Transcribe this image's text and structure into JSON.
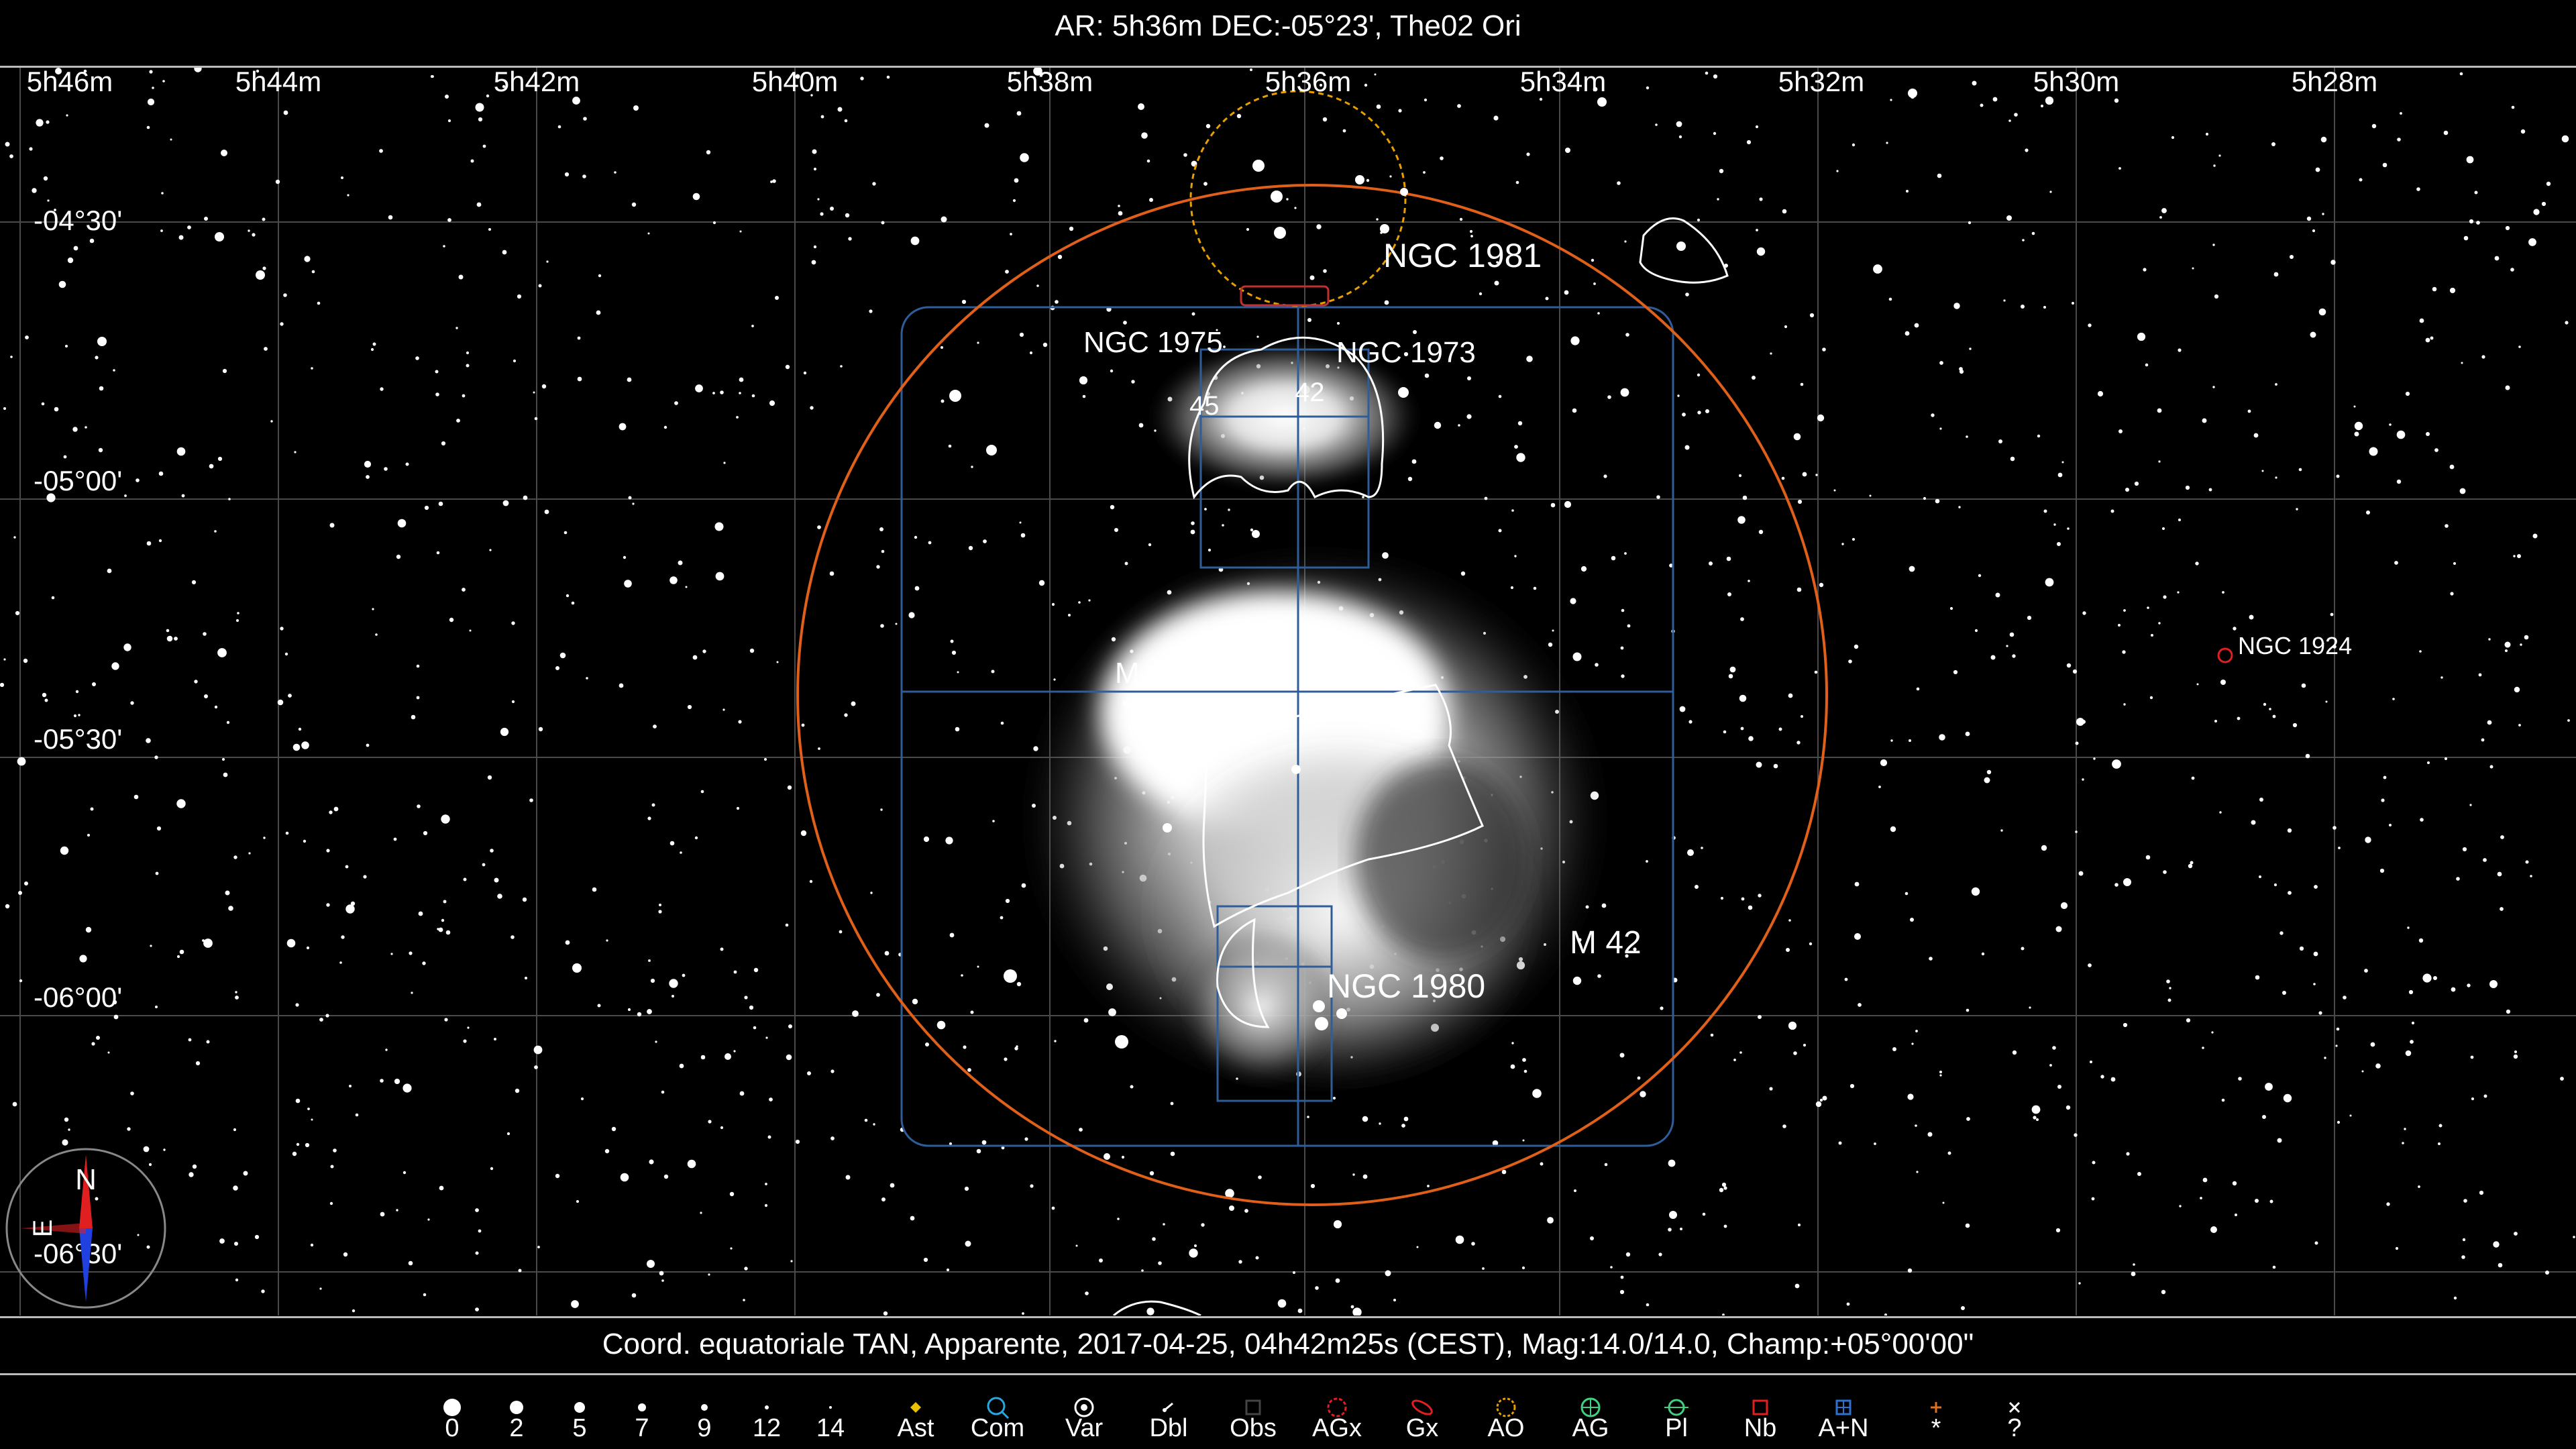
{
  "header": {
    "title": "AR:  5h36m DEC:-05°23', The02 Ori"
  },
  "ra_labels": [
    "5h46m",
    "5h44m",
    "5h42m",
    "5h40m",
    "5h38m",
    "5h36m",
    "5h34m",
    "5h32m",
    "5h30m",
    "5h28m"
  ],
  "dec_labels": [
    "-04°30'",
    "-05°00'",
    "-05°30'",
    "-06°00'",
    "-06°30'"
  ],
  "objects": {
    "ngc1981": "NGC 1981",
    "ngc1975": "NGC 1975",
    "ngc1973": "NGC 1973",
    "m43": "M 43",
    "m42": "M 42",
    "ngc1980": "NGC 1980",
    "ngc1924": "NGC 1924",
    "num45": "45",
    "num42": "42"
  },
  "compass": {
    "north": "N",
    "east": "E"
  },
  "status": {
    "text": "Coord. equatoriale TAN, Apparente, 2017-04-25, 04h42m25s (CEST), Mag:14.0/14.0, Champ:+05°00'00\""
  },
  "legend": [
    {
      "label": "0",
      "icon": "mag-dot"
    },
    {
      "label": "2",
      "icon": "mag-dot"
    },
    {
      "label": "5",
      "icon": "mag-dot"
    },
    {
      "label": "7",
      "icon": "mag-dot"
    },
    {
      "label": "9",
      "icon": "mag-dot"
    },
    {
      "label": "12",
      "icon": "mag-dot"
    },
    {
      "label": "14",
      "icon": "mag-dot"
    },
    {
      "label": "Ast",
      "icon": "asterism-icon",
      "color": "#e8c200"
    },
    {
      "label": "Com",
      "icon": "comet-icon",
      "color": "#29a8e0"
    },
    {
      "label": "Var",
      "icon": "variable-star-icon",
      "color": "#ffffff"
    },
    {
      "label": "Dbl",
      "icon": "double-star-icon",
      "color": "#ffffff"
    },
    {
      "label": "Obs",
      "icon": "obscure-nebula-icon",
      "color": "#444444"
    },
    {
      "label": "AGx",
      "icon": "galaxy-cluster-icon",
      "color": "#e02020"
    },
    {
      "label": "Gx",
      "icon": "galaxy-icon",
      "color": "#e02020"
    },
    {
      "label": "AO",
      "icon": "open-cluster-icon",
      "color": "#e8a000"
    },
    {
      "label": "AG",
      "icon": "globular-cluster-icon",
      "color": "#40d080"
    },
    {
      "label": "Pl",
      "icon": "planetary-nebula-icon",
      "color": "#40d080"
    },
    {
      "label": "Nb",
      "icon": "nebula-icon",
      "color": "#e02020"
    },
    {
      "label": "A+N",
      "icon": "cluster-nebula-icon",
      "color": "#3070d0"
    },
    {
      "label": "*",
      "icon": "star-icon",
      "color": "#e07020"
    },
    {
      "label": "?",
      "icon": "unknown-icon",
      "color": "#ffffff"
    }
  ],
  "colors": {
    "field_circle": "#e0601a",
    "ngc1981_circle": "#e8a000",
    "mosaic": "#2f5d9a",
    "grid": "#4a4a4a"
  }
}
